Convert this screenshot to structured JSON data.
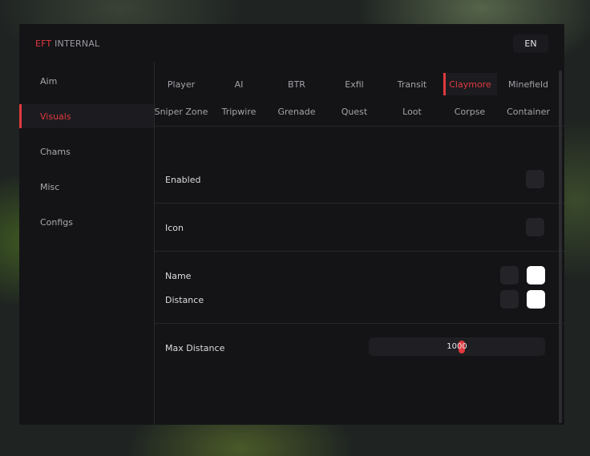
{
  "window": {
    "brand_accent": "EFT",
    "brand_rest": "INTERNAL",
    "language": "EN"
  },
  "sidebar": {
    "items": [
      {
        "label": "Aim",
        "active": false
      },
      {
        "label": "Visuals",
        "active": true
      },
      {
        "label": "Chams",
        "active": false
      },
      {
        "label": "Misc",
        "active": false
      },
      {
        "label": "Configs",
        "active": false
      }
    ]
  },
  "tabs": {
    "row1": [
      "Player",
      "AI",
      "BTR",
      "Exfil",
      "Transit",
      "Claymore",
      "Minefield"
    ],
    "row2": [
      "Sniper Zone",
      "Tripwire",
      "Grenade",
      "Quest",
      "Loot",
      "Corpse",
      "Container"
    ],
    "active": "Claymore"
  },
  "settings": {
    "enabled_label": "Enabled",
    "icon_label": "Icon",
    "name_label": "Name",
    "distance_label": "Distance",
    "max_distance_label": "Max Distance",
    "max_distance_value": "1000",
    "max_distance_fraction": 0.5
  },
  "colors": {
    "accent": "#e0393e",
    "panel": "#141417",
    "swatch": "#ffffff"
  }
}
